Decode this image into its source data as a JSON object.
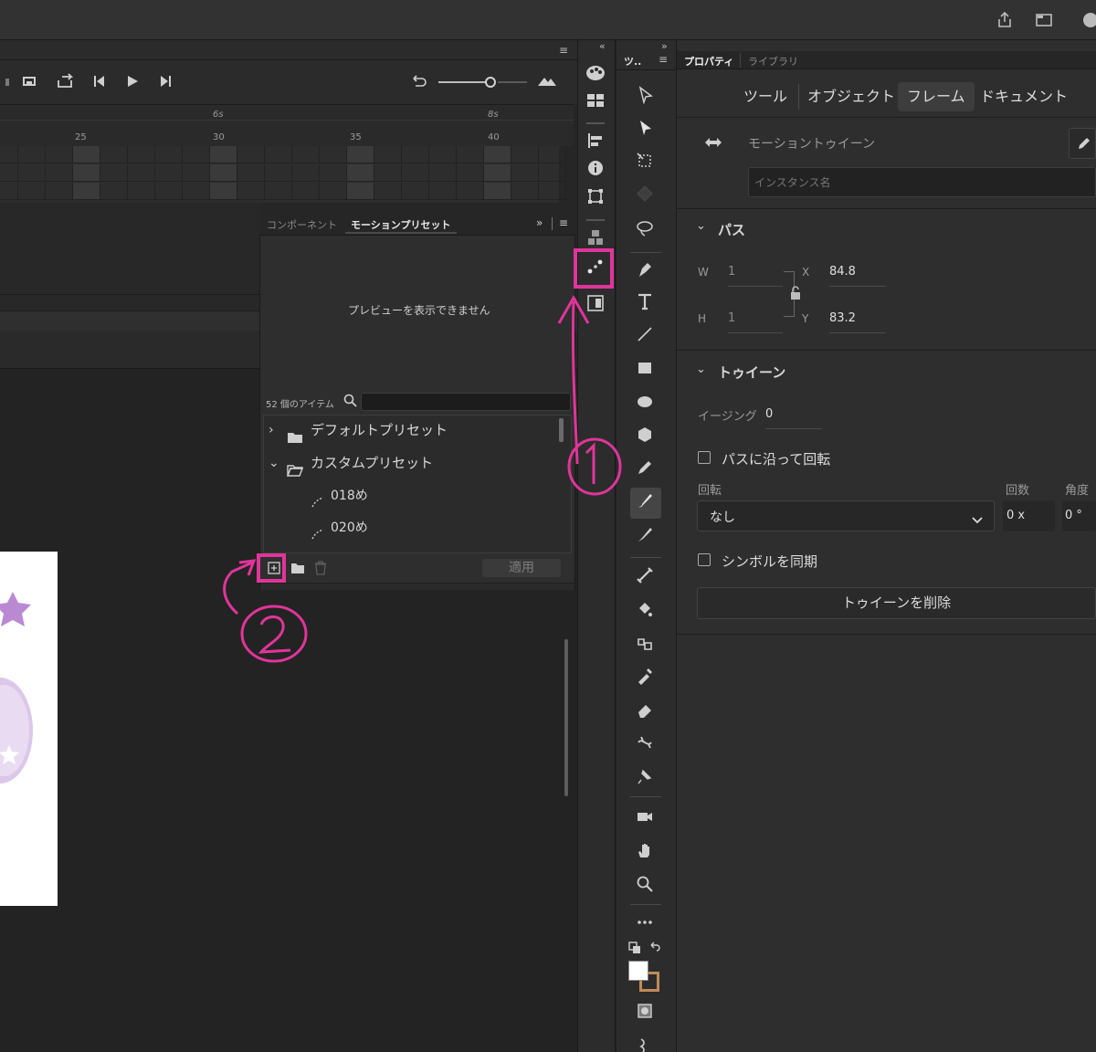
{
  "timeline": {
    "ruler_time_labels": [
      "6s",
      "8s"
    ],
    "ruler_frame_labels": [
      "25",
      "30",
      "35",
      "40"
    ]
  },
  "motion_presets": {
    "tabs": [
      "コンポーネント",
      "モーションプリセット"
    ],
    "preview_message": "プレビューを表示できません",
    "item_count": "52 個のアイテム",
    "search_placeholder": "",
    "tree": [
      {
        "label": "デフォルトプリセット",
        "expanded": false,
        "type": "folder"
      },
      {
        "label": "カスタムプリセット",
        "expanded": true,
        "type": "folder"
      },
      {
        "label": "018め",
        "type": "preset"
      },
      {
        "label": "020め",
        "type": "preset"
      }
    ],
    "apply_label": "適用"
  },
  "tools_tab_label": "ツ..",
  "properties": {
    "tabs": [
      "プロパティ",
      "ライブラリ"
    ],
    "subtabs": [
      "ツール",
      "オブジェクト",
      "フレーム",
      "ドキュメント"
    ],
    "selected_subtab": "フレーム",
    "tween_type": "モーショントゥイーン",
    "instance_name_placeholder": "インスタンス名",
    "path_section": "パス",
    "w_label": "W",
    "w_value": "1",
    "h_label": "H",
    "h_value": "1",
    "x_label": "X",
    "x_value": "84.8",
    "y_label": "Y",
    "y_value": "83.2",
    "tween_section": "トゥイーン",
    "easing_label": "イージング",
    "easing_value": "0",
    "orient_to_path": "パスに沿って回転",
    "rotate_label": "回転",
    "rotate_value": "なし",
    "count_label": "回数",
    "count_value": "0 x",
    "angle_label": "角度",
    "angle_value": "0 °",
    "sync_symbols": "シンボルを同期",
    "remove_tween": "トゥイーンを削除"
  },
  "annotations": {
    "accent": "#e0359a"
  }
}
